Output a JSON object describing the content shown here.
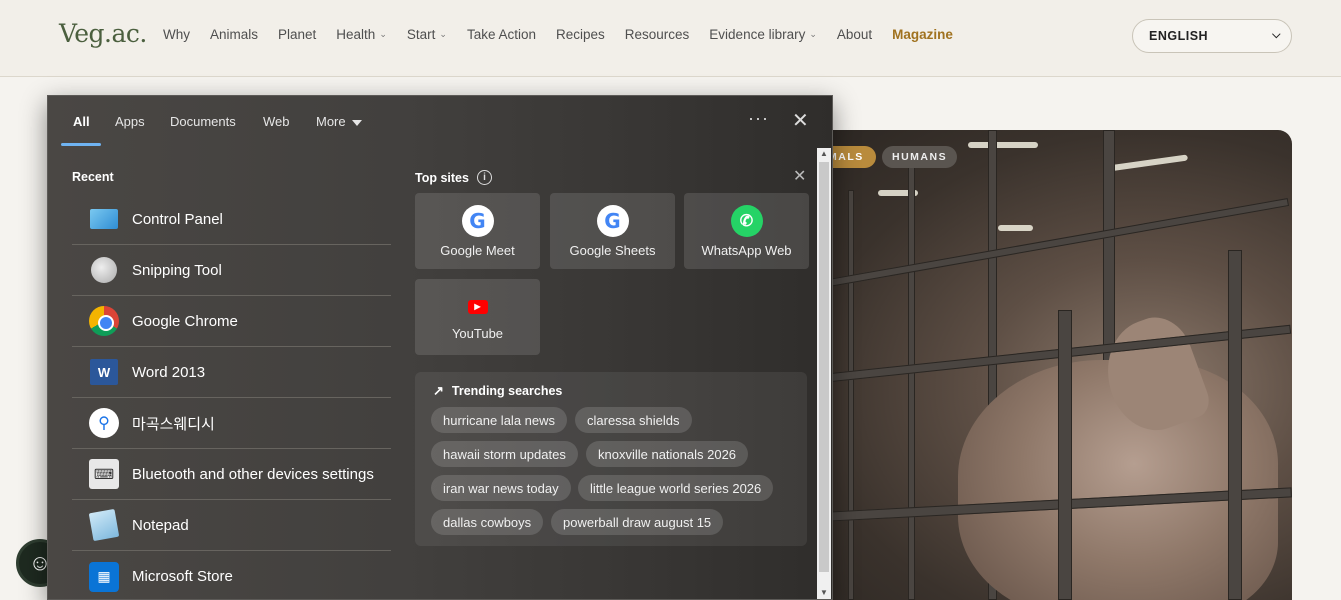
{
  "site": {
    "logo": "Veg.ac.",
    "nav": [
      {
        "label": "Why"
      },
      {
        "label": "Animals"
      },
      {
        "label": "Planet"
      },
      {
        "label": "Health",
        "dropdown": true
      },
      {
        "label": "Start",
        "dropdown": true
      },
      {
        "label": "Take Action"
      },
      {
        "label": "Recipes"
      },
      {
        "label": "Resources"
      },
      {
        "label": "Evidence library",
        "dropdown": true
      },
      {
        "label": "About"
      },
      {
        "label": "Magazine",
        "highlight": true
      }
    ],
    "language": "ENGLISH",
    "hero_tags": [
      "MALS",
      "HUMANS"
    ],
    "accent_color": "#a0721f"
  },
  "search": {
    "tabs": [
      "All",
      "Apps",
      "Documents",
      "Web",
      "More"
    ],
    "active_tab": "All",
    "recent_title": "Recent",
    "recent": [
      {
        "label": "Control Panel",
        "icon": "control-panel-icon"
      },
      {
        "label": "Snipping Tool",
        "icon": "snipping-tool-icon"
      },
      {
        "label": "Google Chrome",
        "icon": "chrome-icon"
      },
      {
        "label": "Word 2013",
        "icon": "word-icon"
      },
      {
        "label": "마곡스웨디시",
        "icon": "search-icon"
      },
      {
        "label": "Bluetooth and other devices settings",
        "icon": "bluetooth-settings-icon"
      },
      {
        "label": "Notepad",
        "icon": "notepad-icon"
      },
      {
        "label": "Microsoft Store",
        "icon": "store-icon"
      }
    ],
    "top_sites_title": "Top sites",
    "top_sites": [
      {
        "label": "Google Meet",
        "icon": "google-icon"
      },
      {
        "label": "Google Sheets",
        "icon": "google-icon"
      },
      {
        "label": "WhatsApp Web",
        "icon": "whatsapp-icon"
      },
      {
        "label": "YouTube",
        "icon": "youtube-icon"
      }
    ],
    "trending_title": "Trending searches",
    "trending": [
      "hurricane lala news",
      "claressa shields",
      "hawaii storm updates",
      "knoxville nationals 2026",
      "iran war news today",
      "little league world series 2026",
      "dallas cowboys",
      "powerball draw august 15"
    ]
  }
}
